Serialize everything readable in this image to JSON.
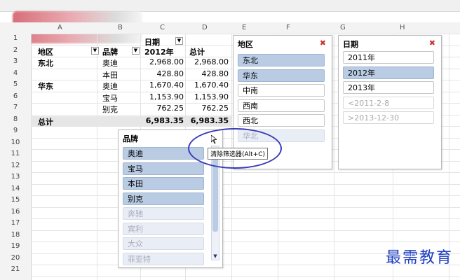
{
  "columns": [
    "A",
    "B",
    "C",
    "D",
    "E",
    "F",
    "G",
    "H"
  ],
  "rows": [
    "1",
    "2",
    "3",
    "4",
    "5",
    "6",
    "7",
    "8",
    "9",
    "10",
    "11",
    "12",
    "13",
    "14",
    "15",
    "16",
    "17",
    "18",
    "19",
    "20",
    "21"
  ],
  "pivot": {
    "header_date": "日期",
    "header_region": "地区",
    "header_brand": "品牌",
    "header_year": "2012年",
    "header_total": "总计",
    "rows": [
      {
        "region": "东北",
        "brand": "奥迪",
        "v1": "2,968.00",
        "v2": "2,968.00"
      },
      {
        "region": "",
        "brand": "本田",
        "v1": "428.80",
        "v2": "428.80"
      },
      {
        "region": "华东",
        "brand": "奥迪",
        "v1": "1,670.40",
        "v2": "1,670.40"
      },
      {
        "region": "",
        "brand": "宝马",
        "v1": "1,153.90",
        "v2": "1,153.90"
      },
      {
        "region": "",
        "brand": "别克",
        "v1": "762.25",
        "v2": "762.25"
      }
    ],
    "grand_label": "总计",
    "grand_v1": "6,983.35",
    "grand_v2": "6,983.35"
  },
  "slicer_region": {
    "title": "地区",
    "items": [
      {
        "label": "东北",
        "state": "sel"
      },
      {
        "label": "华东",
        "state": "sel"
      },
      {
        "label": "中南",
        "state": "unsel"
      },
      {
        "label": "西南",
        "state": "unsel"
      },
      {
        "label": "西北",
        "state": "unsel"
      },
      {
        "label": "华北",
        "state": "dim"
      }
    ]
  },
  "slicer_date": {
    "title": "日期",
    "items": [
      {
        "label": "2011年",
        "state": "unsel"
      },
      {
        "label": "2012年",
        "state": "sel"
      },
      {
        "label": "2013年",
        "state": "unsel"
      },
      {
        "label": "<2011-2-8",
        "state": "dimwhite"
      },
      {
        "label": ">2013-12-30",
        "state": "dimwhite"
      }
    ]
  },
  "slicer_brand": {
    "title": "品牌",
    "items": [
      {
        "label": "奥迪",
        "state": "sel"
      },
      {
        "label": "宝马",
        "state": "sel"
      },
      {
        "label": "本田",
        "state": "sel"
      },
      {
        "label": "别克",
        "state": "sel"
      },
      {
        "label": "奔驰",
        "state": "dim"
      },
      {
        "label": "宾利",
        "state": "dim"
      },
      {
        "label": "大众",
        "state": "dim"
      },
      {
        "label": "菲亚特",
        "state": "dim"
      }
    ],
    "tooltip": "清除筛选器(Alt+C)"
  },
  "watermark": "最需教育",
  "colors": {
    "selected": "#b9cce4",
    "accent": "#3b3bb8"
  }
}
